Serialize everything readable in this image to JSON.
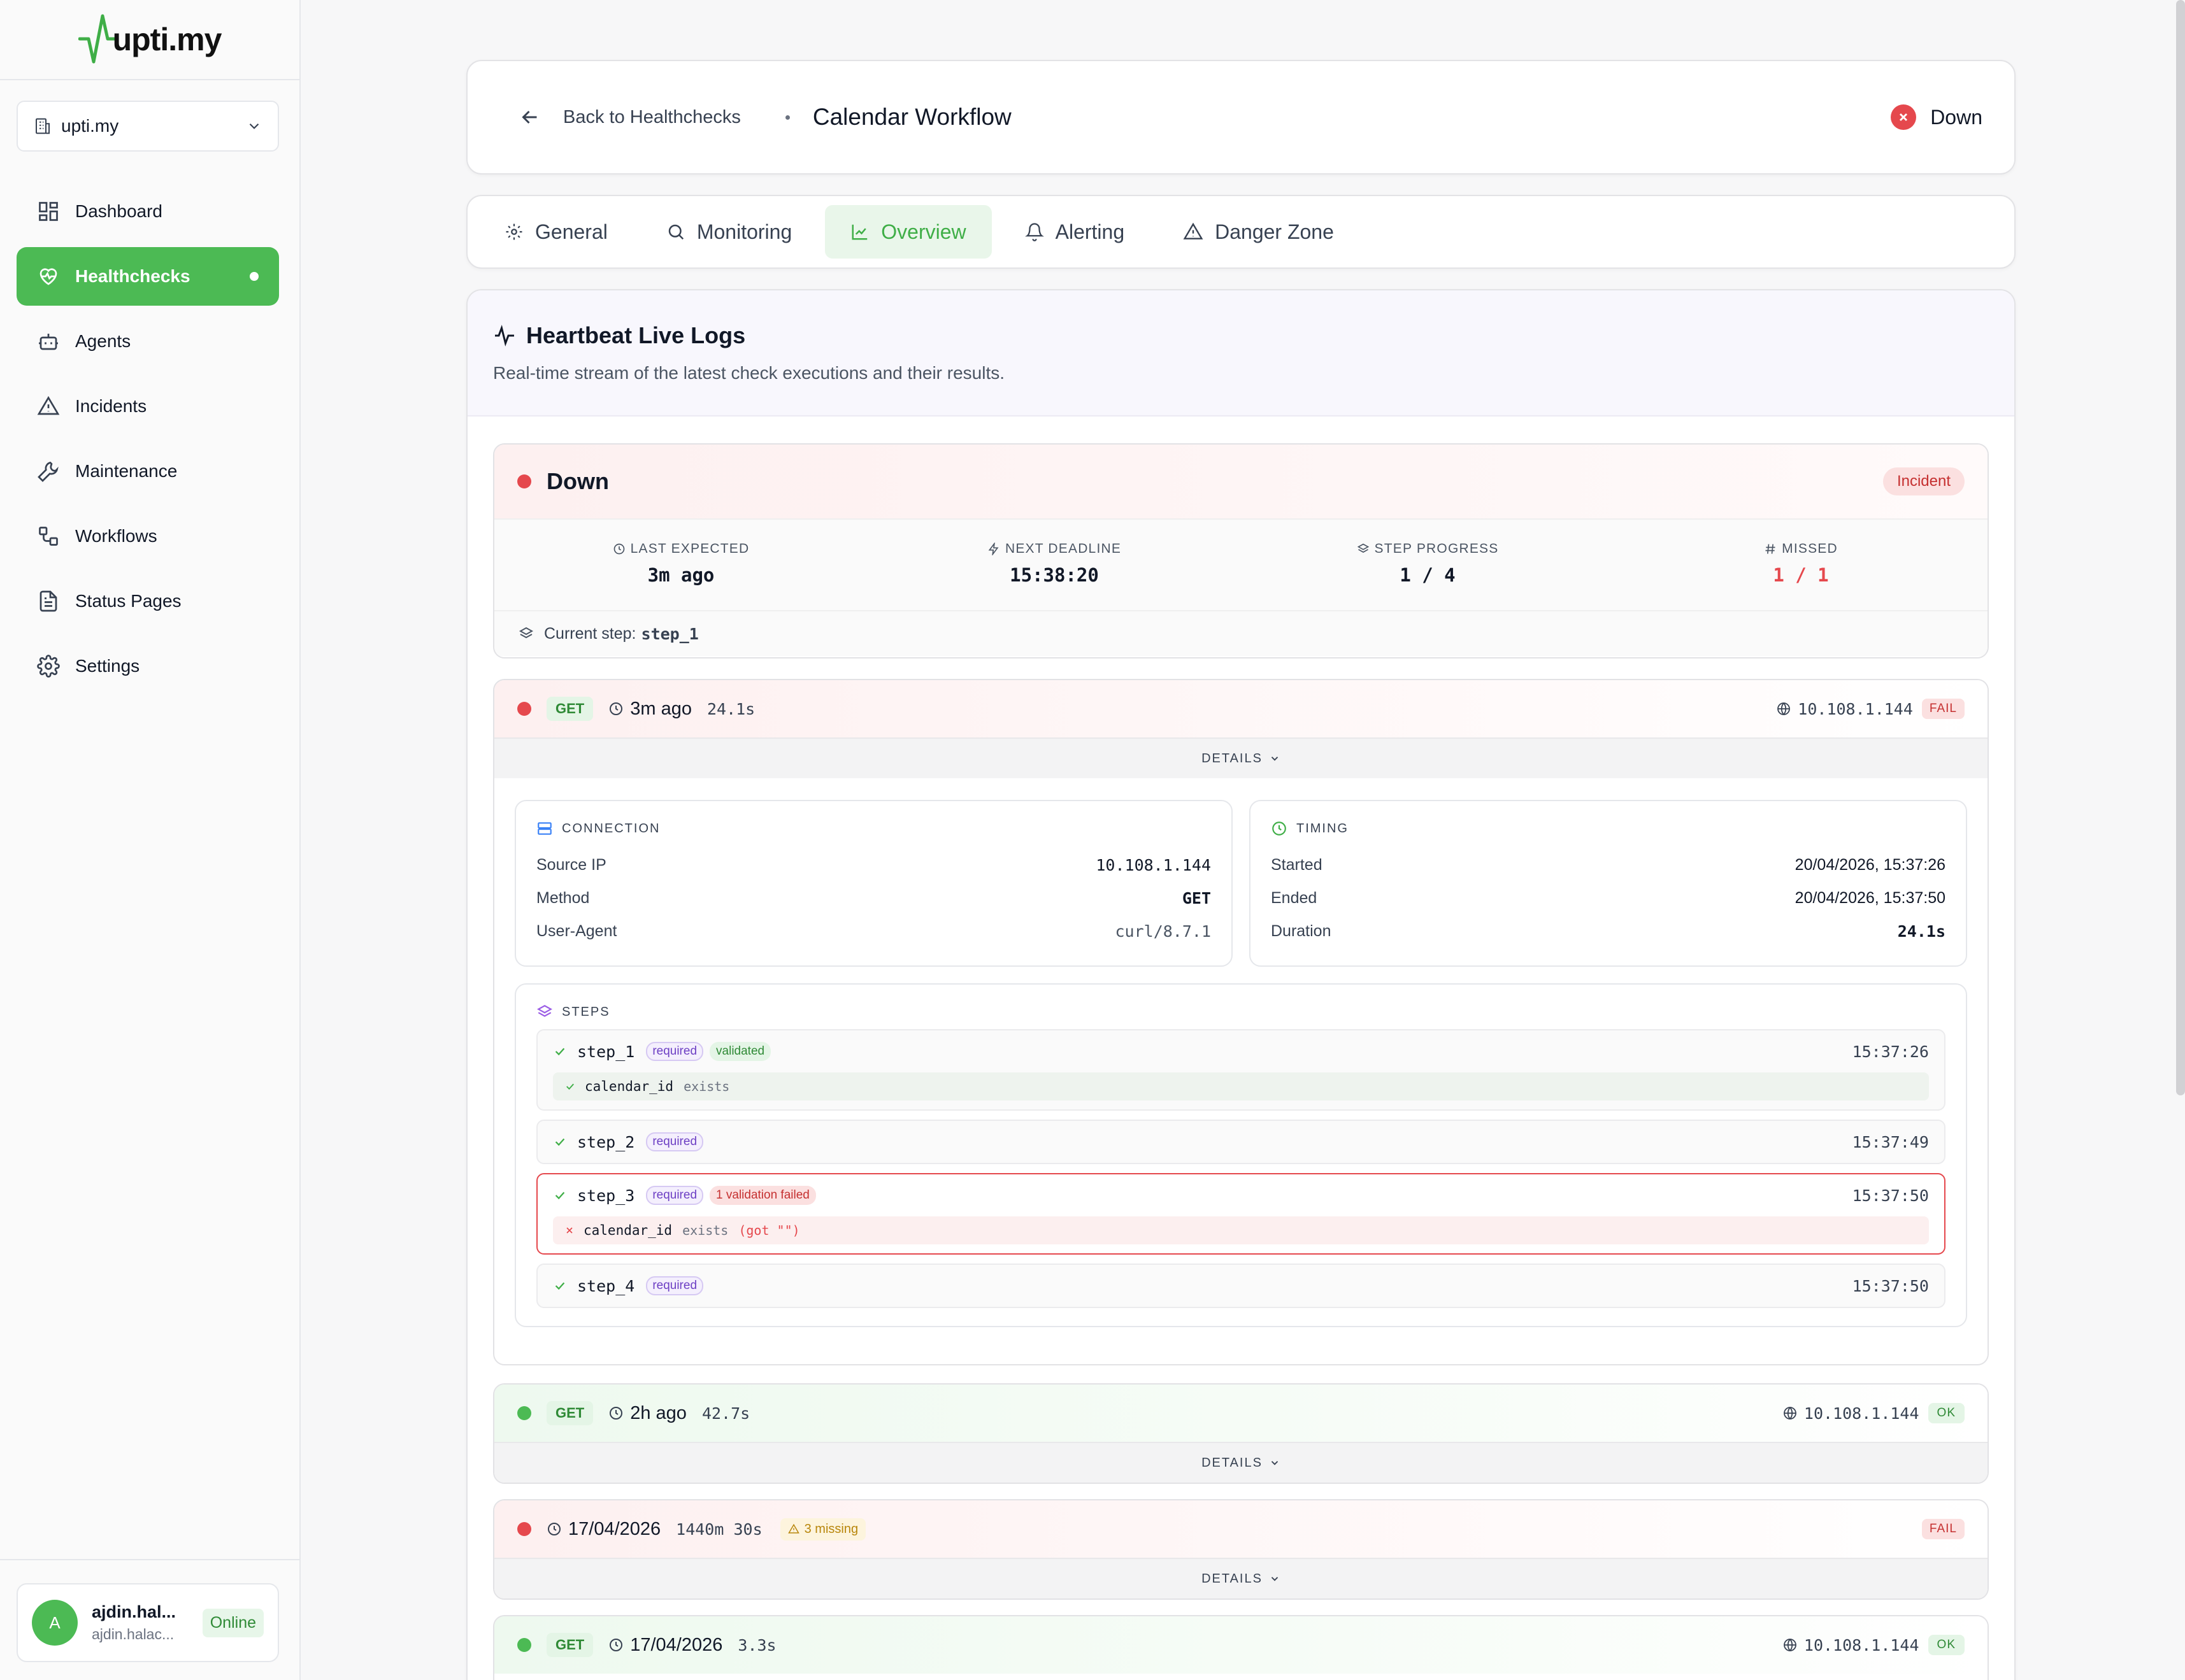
{
  "brand": {
    "logo_text": "upti.my"
  },
  "sidebar": {
    "org": "upti.my",
    "items": [
      {
        "label": "Dashboard"
      },
      {
        "label": "Healthchecks"
      },
      {
        "label": "Agents"
      },
      {
        "label": "Incidents"
      },
      {
        "label": "Maintenance"
      },
      {
        "label": "Workflows"
      },
      {
        "label": "Status Pages"
      },
      {
        "label": "Settings"
      }
    ],
    "user": {
      "initial": "A",
      "name": "ajdin.hal...",
      "email": "ajdin.halac...",
      "status": "Online"
    }
  },
  "header": {
    "back_label": "Back to Healthchecks",
    "title": "Calendar Workflow",
    "status": "Down"
  },
  "tabs": [
    {
      "label": "General"
    },
    {
      "label": "Monitoring"
    },
    {
      "label": "Overview"
    },
    {
      "label": "Alerting"
    },
    {
      "label": "Danger Zone"
    }
  ],
  "logs": {
    "title": "Heartbeat Live Logs",
    "subtitle": "Real-time stream of the latest check executions and their results.",
    "summary": {
      "status": "Down",
      "badge": "Incident",
      "stats": [
        {
          "label": "LAST EXPECTED",
          "value": "3m ago"
        },
        {
          "label": "NEXT DEADLINE",
          "value": "15:38:20"
        },
        {
          "label": "STEP PROGRESS",
          "value": "1 / 4"
        },
        {
          "label": "MISSED",
          "value": "1 / 1"
        }
      ],
      "current_step_label": "Current step:",
      "current_step": "step_1"
    },
    "details_label": "DETAILS",
    "entries": [
      {
        "method": "GET",
        "time": "3m ago",
        "duration": "24.1s",
        "ip": "10.108.1.144",
        "result": "FAIL"
      },
      {
        "method": "GET",
        "time": "2h ago",
        "duration": "42.7s",
        "ip": "10.108.1.144",
        "result": "OK"
      },
      {
        "time": "17/04/2026",
        "duration": "1440m 30s",
        "missing": "3 missing",
        "result": "FAIL"
      },
      {
        "method": "GET",
        "time": "17/04/2026",
        "duration": "3.3s",
        "ip": "10.108.1.144",
        "result": "OK"
      }
    ],
    "connection": {
      "title": "CONNECTION",
      "rows": [
        {
          "k": "Source IP",
          "v": "10.108.1.144"
        },
        {
          "k": "Method",
          "v": "GET"
        },
        {
          "k": "User-Agent",
          "v": "curl/8.7.1"
        }
      ]
    },
    "timing": {
      "title": "TIMING",
      "rows": [
        {
          "k": "Started",
          "v": "20/04/2026, 15:37:26"
        },
        {
          "k": "Ended",
          "v": "20/04/2026, 15:37:50"
        },
        {
          "k": "Duration",
          "v": "24.1s"
        }
      ]
    },
    "steps": {
      "title": "STEPS",
      "required_tag": "required",
      "items": [
        {
          "name": "step_1",
          "tag": "validated",
          "time": "15:37:26",
          "check": {
            "field": "calendar_id",
            "op": "exists"
          }
        },
        {
          "name": "step_2",
          "time": "15:37:49"
        },
        {
          "name": "step_3",
          "tag": "1 validation failed",
          "time": "15:37:50",
          "check": {
            "field": "calendar_id",
            "op": "exists",
            "got": "(got \"\")"
          }
        },
        {
          "name": "step_4",
          "time": "15:37:50"
        }
      ]
    }
  },
  "colors": {
    "accent": "#4cba54",
    "danger": "#e5484d",
    "required": "#6d3fc4"
  }
}
